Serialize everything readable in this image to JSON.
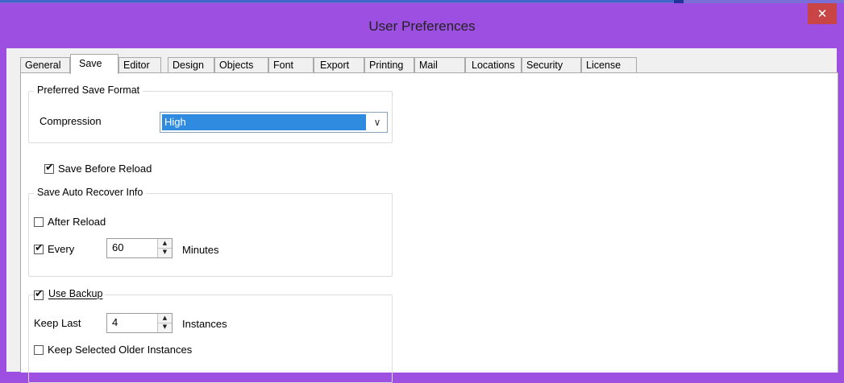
{
  "window": {
    "title": "User Preferences",
    "close_icon": "close-icon",
    "close_glyph": "✕"
  },
  "tabs": [
    {
      "label": "General"
    },
    {
      "label": "Save",
      "active": true
    },
    {
      "label": "Editor"
    },
    {
      "label": "Design"
    },
    {
      "label": "Objects"
    },
    {
      "label": "Font"
    },
    {
      "label": "Export"
    },
    {
      "label": "Printing"
    },
    {
      "label": "Mail"
    },
    {
      "label": "Locations"
    },
    {
      "label": "Security"
    },
    {
      "label": "License"
    }
  ],
  "preferred_save_format": {
    "legend": "Preferred Save Format",
    "compression_label": "Compression",
    "compression_value": "High",
    "dropdown_glyph": "∨"
  },
  "save_before_reload": {
    "label": "Save Before Reload",
    "checked": true
  },
  "auto_recover": {
    "legend": "Save Auto Recover Info",
    "after_reload": {
      "label": "After Reload",
      "checked": false
    },
    "every": {
      "label": "Every",
      "checked": true,
      "value": "60",
      "unit": "Minutes"
    }
  },
  "backup": {
    "use_backup": {
      "label": "Use Backup",
      "checked": true
    },
    "keep_last": {
      "label": "Keep Last",
      "value": "4",
      "unit": "Instances"
    },
    "keep_selected": {
      "label": "Keep Selected Older Instances",
      "checked": false
    }
  },
  "glyphs": {
    "check": "✔",
    "up": "▲",
    "down": "▼"
  },
  "colors": {
    "title_bg": "#9c4fe0",
    "close_bg": "#c94545",
    "selection": "#2f8be0"
  }
}
